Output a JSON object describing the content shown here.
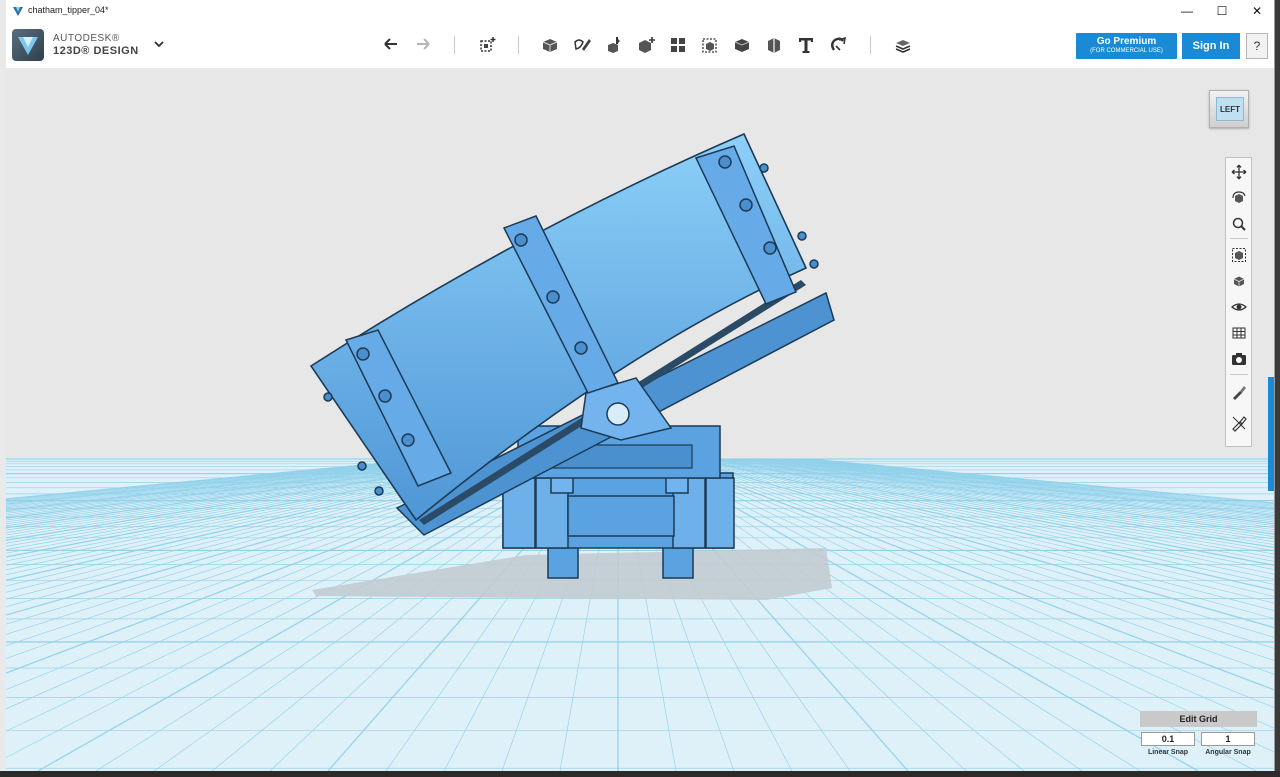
{
  "window": {
    "title": "chatham_tipper_04*",
    "minimize": "—",
    "maximize": "☐",
    "close": "✕"
  },
  "brand": {
    "line1": "AUTODESK®",
    "line2": "123D® DESIGN"
  },
  "toolbar": {
    "tools": [
      {
        "name": "undo-icon"
      },
      {
        "name": "redo-icon"
      },
      {
        "name": "transform-icon"
      },
      {
        "name": "primitives-icon"
      },
      {
        "name": "sketch-icon"
      },
      {
        "name": "construct-icon"
      },
      {
        "name": "modify-icon"
      },
      {
        "name": "pattern-icon"
      },
      {
        "name": "grouping-icon"
      },
      {
        "name": "combine-icon"
      },
      {
        "name": "measure-icon"
      },
      {
        "name": "text-icon"
      },
      {
        "name": "snap-icon"
      },
      {
        "name": "material-icon"
      }
    ],
    "premium_label": "Go Premium",
    "premium_sub": "(FOR COMMERCIAL USE)",
    "signin_label": "Sign In",
    "help_label": "?"
  },
  "viewcube": {
    "face": "LEFT"
  },
  "navbar": {
    "buttons": [
      "pan-icon",
      "orbit-icon",
      "zoom-icon",
      "fit-icon",
      "view-icon",
      "visibility-icon",
      "grid-icon",
      "screenshot-icon",
      "material-brush-icon",
      "outline-icon"
    ]
  },
  "grid": {
    "title": "Edit Grid",
    "linear_value": "0.1",
    "linear_label": "Linear Snap",
    "angular_value": "1",
    "angular_label": "Angular Snap"
  },
  "colors": {
    "model": "#5ba2e0",
    "model_edge": "#1c3a55",
    "grid_line": "#8fd0ea",
    "floor": "#dff1f8",
    "accent": "#1a8ad4"
  }
}
